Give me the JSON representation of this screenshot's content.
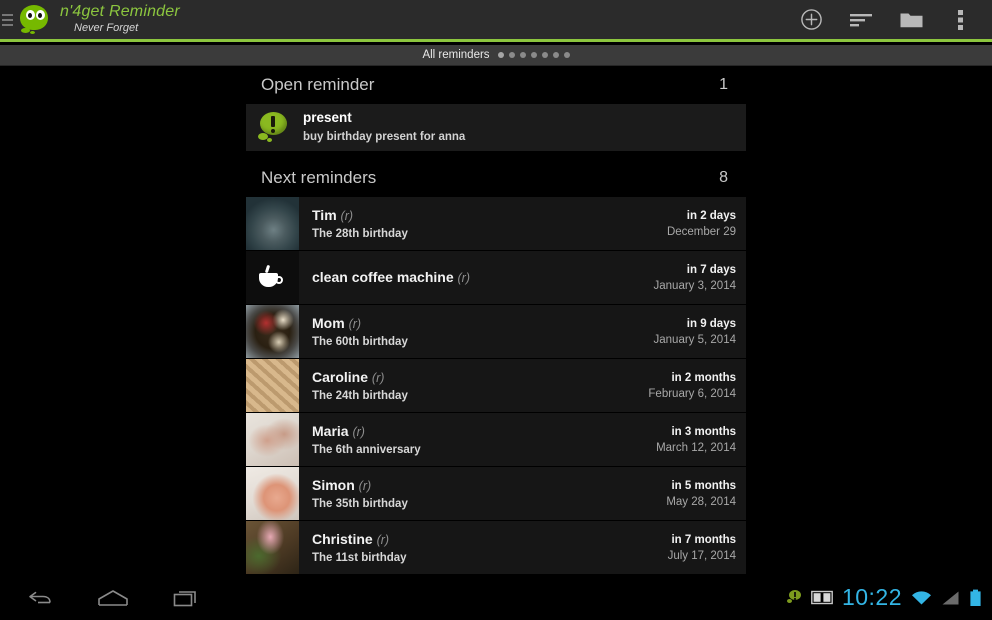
{
  "titlebar": {
    "drawer_icon": "hamburger-icon",
    "logo_icon": "app-mascot-logo",
    "app_name": "n'4get Reminder",
    "tagline": "Never Forget",
    "actions": [
      {
        "name": "add-reminder-button",
        "icon": "plus-circle-icon"
      },
      {
        "name": "sort-button",
        "icon": "sort-lines-icon"
      },
      {
        "name": "folder-button",
        "icon": "folder-icon"
      },
      {
        "name": "overflow-menu-button",
        "icon": "more-vertical-icon"
      }
    ]
  },
  "tabstrip": {
    "label": "All reminders",
    "page_dots": 7,
    "active_dot": 0
  },
  "sections": [
    {
      "title": "Open reminder",
      "count": "1",
      "open_items": [
        {
          "icon": "alert-bubble-icon",
          "name": "present",
          "description": "buy birthday present for anna"
        }
      ]
    },
    {
      "title": "Next reminders",
      "count": "8",
      "items": [
        {
          "thumb": "snowy-tree-photo",
          "thumb_class": "th-tree",
          "title": "Tim",
          "tag": "(r)",
          "subtitle": "The 28th birthday",
          "when": "in 2 days",
          "date": "December 29"
        },
        {
          "thumb": "coffee-cup-icon",
          "thumb_class": "cup-icon",
          "title": "clean coffee machine",
          "tag": "(r)",
          "subtitle": "",
          "when": "in 7 days",
          "date": "January 3, 2014"
        },
        {
          "thumb": "wreath-photo",
          "thumb_class": "th-wreath",
          "title": "Mom",
          "tag": "(r)",
          "subtitle": "The 60th birthday",
          "when": "in 9 days",
          "date": "January 5, 2014"
        },
        {
          "thumb": "cookie-texture-photo",
          "thumb_class": "th-cookie",
          "title": "Caroline",
          "tag": "(r)",
          "subtitle": "The 24th birthday",
          "when": "in 2 months",
          "date": "February 6, 2014"
        },
        {
          "thumb": "latte-heart-photo",
          "thumb_class": "th-heart",
          "title": "Maria",
          "tag": "(r)",
          "subtitle": "The 6th anniversary",
          "when": "in 3 months",
          "date": "March 12, 2014"
        },
        {
          "thumb": "baby-hand-photo",
          "thumb_class": "th-hand",
          "title": "Simon",
          "tag": "(r)",
          "subtitle": "The 35th birthday",
          "when": "in 5 months",
          "date": "May 28, 2014"
        },
        {
          "thumb": "bunny-photo",
          "thumb_class": "th-bunny",
          "title": "Christine",
          "tag": "(r)",
          "subtitle": "The 11st birthday",
          "when": "in 7 months",
          "date": "July 17, 2014"
        }
      ]
    }
  ],
  "navbar": {
    "buttons": [
      {
        "name": "back-button",
        "icon": "back-arrow-icon"
      },
      {
        "name": "home-button",
        "icon": "home-icon"
      },
      {
        "name": "recents-button",
        "icon": "recent-apps-icon"
      }
    ],
    "systray": {
      "notification_icon": "app-notification-bubble-icon",
      "reader_icon": "book-icon",
      "clock": "10:22",
      "wifi_icon": "wifi-icon",
      "signal_icon": "cell-signal-icon",
      "battery_icon": "battery-full-icon"
    }
  },
  "colors": {
    "accent_green": "#8cc63f",
    "logo_green": "#76b900",
    "clock_blue": "#33b5e5",
    "titlebar_bg": "#2b2b2b",
    "tabstrip_bg": "#3b3b3b",
    "row_bg": "#161616",
    "page_bg": "#000000"
  }
}
